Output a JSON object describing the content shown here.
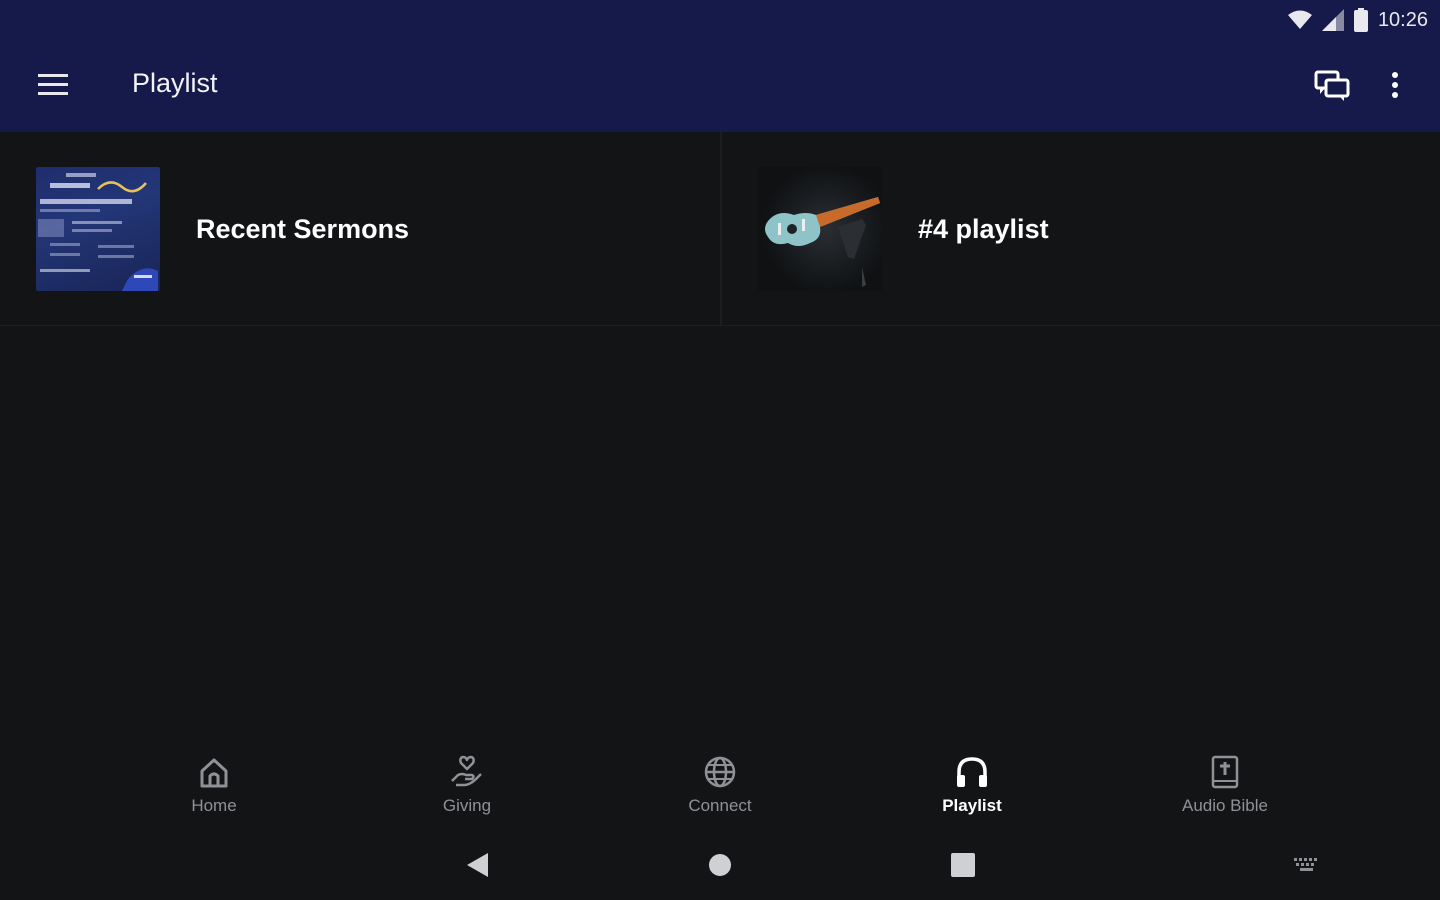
{
  "status_bar": {
    "time": "10:26",
    "icons": [
      "wifi-icon",
      "signal-icon",
      "battery-icon"
    ]
  },
  "app_bar": {
    "title": "Playlist",
    "icons": [
      "menu-icon",
      "chat-icon",
      "more-vert-icon"
    ]
  },
  "playlists": [
    {
      "title": "Recent Sermons",
      "thumbnail": "sermon-flyer-image"
    },
    {
      "title": "#4 playlist",
      "thumbnail": "guitar-image"
    }
  ],
  "bottom_nav": {
    "items": [
      {
        "label": "Home",
        "icon": "home-icon",
        "active": false
      },
      {
        "label": "Giving",
        "icon": "giving-hand-heart-icon",
        "active": false
      },
      {
        "label": "Connect",
        "icon": "globe-icon",
        "active": false
      },
      {
        "label": "Playlist",
        "icon": "headphones-icon",
        "active": true
      },
      {
        "label": "Audio Bible",
        "icon": "bible-icon",
        "active": false
      }
    ]
  },
  "system_nav": {
    "icons": [
      "back-icon",
      "home-circle-icon",
      "recents-icon",
      "keyboard-icon"
    ]
  },
  "colors": {
    "app_bar": "#161a4a",
    "background": "#121416",
    "inactive_nav": "#8f9196",
    "active_nav": "#ffffff"
  }
}
